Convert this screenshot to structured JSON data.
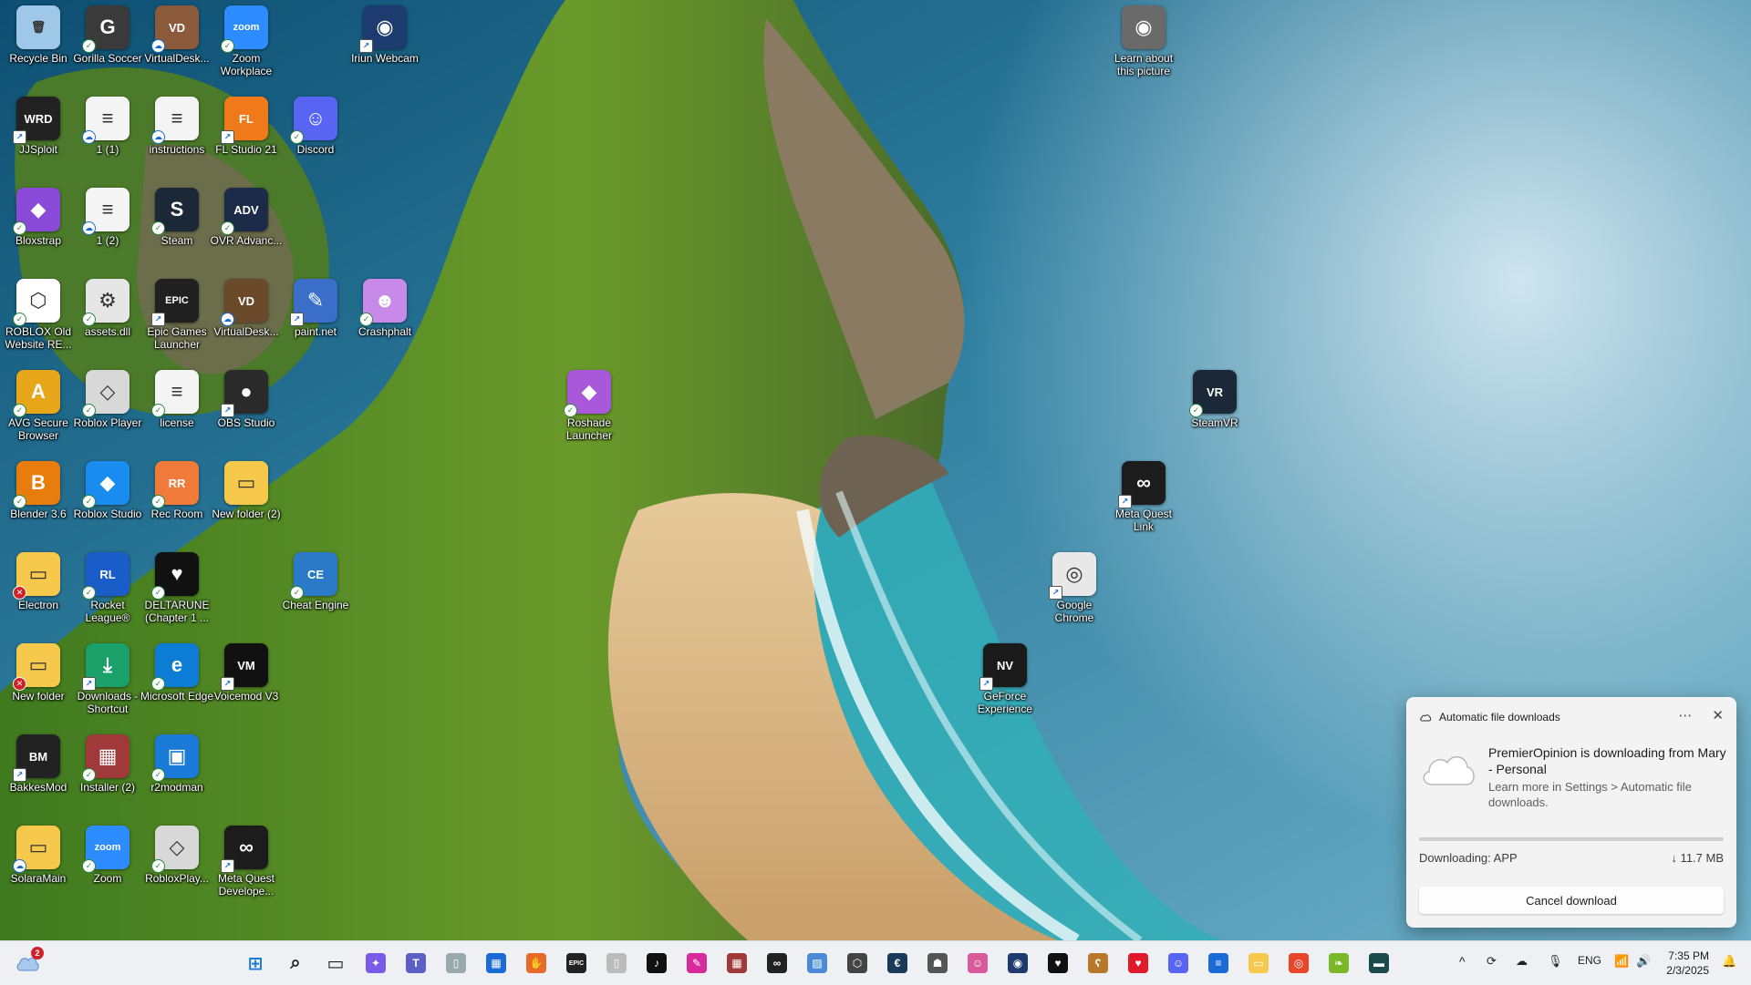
{
  "desktop": {
    "icons": [
      {
        "label": "Recycle Bin",
        "glyph": "🗑",
        "color": "#9fc7e8",
        "badge": "none"
      },
      {
        "label": "Gorilla Soccer",
        "glyph": "G",
        "color": "#3a3a3a",
        "badge": "ok"
      },
      {
        "label": "VirtualDesk...",
        "glyph": "VD",
        "color": "#8a5a3a",
        "badge": "cloud"
      },
      {
        "label": "Zoom Workplace",
        "glyph": "zoom",
        "color": "#2d8cff",
        "badge": "ok"
      },
      {
        "label": "Iriun Webcam",
        "glyph": "◉",
        "color": "#1d3b6e",
        "badge": "short"
      },
      {
        "label": "JJSploit",
        "glyph": "WRD",
        "color": "#222",
        "badge": "short"
      },
      {
        "label": "1 (1)",
        "glyph": "≡",
        "color": "#f4f4f4",
        "badge": "cloud"
      },
      {
        "label": "instructions",
        "glyph": "≡",
        "color": "#f4f4f4",
        "badge": "cloud"
      },
      {
        "label": "FL Studio 21",
        "glyph": "FL",
        "color": "#f07a1a",
        "badge": "short"
      },
      {
        "label": "Discord",
        "glyph": "☺",
        "color": "#5865f2",
        "badge": "ok"
      },
      {
        "label": "Bloxstrap",
        "glyph": "◆",
        "color": "#8a4ad8",
        "badge": "ok"
      },
      {
        "label": "1 (2)",
        "glyph": "≡",
        "color": "#f4f4f4",
        "badge": "cloud"
      },
      {
        "label": "Steam",
        "glyph": "S",
        "color": "#1b2838",
        "badge": "ok"
      },
      {
        "label": "OVR Advanc...",
        "glyph": "ADV",
        "color": "#1c2c48",
        "badge": "ok"
      },
      {
        "label": "ROBLOX Old Website RE...",
        "glyph": "⬡",
        "color": "#ffffff",
        "badge": "ok"
      },
      {
        "label": "assets.dll",
        "glyph": "⚙",
        "color": "#e6e6e6",
        "badge": "ok"
      },
      {
        "label": "Epic Games Launcher",
        "glyph": "EPIC",
        "color": "#202020",
        "badge": "short"
      },
      {
        "label": "VirtualDesk...",
        "glyph": "VD",
        "color": "#6a4a2a",
        "badge": "cloud"
      },
      {
        "label": "paint.net",
        "glyph": "✎",
        "color": "#3a6ec8",
        "badge": "short"
      },
      {
        "label": "Crashphalt",
        "glyph": "☻",
        "color": "#c78ae8",
        "badge": "ok"
      },
      {
        "label": "AVG Secure Browser",
        "glyph": "A",
        "color": "#e8a61a",
        "badge": "ok"
      },
      {
        "label": "Roblox Player",
        "glyph": "◇",
        "color": "#d8d8d8",
        "badge": "ok"
      },
      {
        "label": "license",
        "glyph": "≡",
        "color": "#f4f4f4",
        "badge": "ok"
      },
      {
        "label": "OBS Studio",
        "glyph": "●",
        "color": "#2a2a2a",
        "badge": "short"
      },
      {
        "label": "Roshade Launcher",
        "glyph": "◆",
        "color": "#a858d8",
        "badge": "ok"
      },
      {
        "label": "SteamVR",
        "glyph": "VR",
        "color": "#1b2838",
        "badge": "ok"
      },
      {
        "label": "Blender 3.6",
        "glyph": "B",
        "color": "#e87d0d",
        "badge": "ok"
      },
      {
        "label": "Roblox Studio",
        "glyph": "◆",
        "color": "#1a8cf0",
        "badge": "ok"
      },
      {
        "label": "Rec Room",
        "glyph": "RR",
        "color": "#f07a3a",
        "badge": "ok"
      },
      {
        "label": "New folder (2)",
        "glyph": "▭",
        "color": "#f6c84c",
        "badge": "none"
      },
      {
        "label": "Meta Quest Link",
        "glyph": "∞",
        "color": "#1c1c1c",
        "badge": "short"
      },
      {
        "label": "Electron",
        "glyph": "▭",
        "color": "#f6c84c",
        "badge": "err"
      },
      {
        "label": "Rocket League®",
        "glyph": "RL",
        "color": "#1a5cc8",
        "badge": "ok"
      },
      {
        "label": "DELTARUNE (Chapter 1 ...",
        "glyph": "♥",
        "color": "#111",
        "badge": "ok"
      },
      {
        "label": "Cheat Engine",
        "glyph": "CE",
        "color": "#2a7ac8",
        "badge": "ok"
      },
      {
        "label": "Google Chrome",
        "glyph": "◎",
        "color": "#e8e8e8",
        "badge": "short"
      },
      {
        "label": "New folder",
        "glyph": "▭",
        "color": "#f6c84c",
        "badge": "err"
      },
      {
        "label": "Downloads - Shortcut",
        "glyph": "⤓",
        "color": "#1aa068",
        "badge": "short"
      },
      {
        "label": "Microsoft Edge",
        "glyph": "e",
        "color": "#0c7cd5",
        "badge": "ok"
      },
      {
        "label": "Voicemod V3",
        "glyph": "VM",
        "color": "#111",
        "badge": "short"
      },
      {
        "label": "GeForce Experience",
        "glyph": "NV",
        "color": "#1a1a1a",
        "badge": "short"
      },
      {
        "label": "BakkesMod",
        "glyph": "BM",
        "color": "#222",
        "badge": "short"
      },
      {
        "label": "Installer (2)",
        "glyph": "▦",
        "color": "#a03a3a",
        "badge": "ok"
      },
      {
        "label": "r2modman",
        "glyph": "▣",
        "color": "#1a7ad8",
        "badge": "ok"
      },
      {
        "label": "SolaraMain",
        "glyph": "▭",
        "color": "#f6c84c",
        "badge": "cloud"
      },
      {
        "label": "Zoom",
        "glyph": "zoom",
        "color": "#2d8cff",
        "badge": "ok"
      },
      {
        "label": "RobloxPlay...",
        "glyph": "◇",
        "color": "#d8d8d8",
        "badge": "ok"
      },
      {
        "label": "Meta Quest Develope...",
        "glyph": "∞",
        "color": "#1c1c1c",
        "badge": "short"
      },
      {
        "label": "Learn about this picture",
        "glyph": "◉",
        "color": "#6a6a6a",
        "badge": "none"
      }
    ]
  },
  "notification": {
    "header": "Automatic file downloads",
    "more_icon": "ellipsis-icon",
    "close_icon": "close-icon",
    "title": "PremierOpinion is downloading from Mary - Personal",
    "subtitle": "Learn more in Settings > Automatic file downloads.",
    "status": "Downloading: APP",
    "size": "↓ 11.7 MB",
    "progress": 0.0,
    "cancel_label": "Cancel download"
  },
  "taskbar": {
    "weather_badge": "2",
    "apps": [
      {
        "name": "start-button",
        "glyph": "⊞",
        "color": "#1a7ad8"
      },
      {
        "name": "search-button",
        "glyph": "⌕",
        "color": "#222"
      },
      {
        "name": "task-view-button",
        "glyph": "▭",
        "color": "#222"
      },
      {
        "name": "copilot-button",
        "glyph": "✦",
        "color": "#7a5ae8"
      },
      {
        "name": "teams-button",
        "glyph": "T",
        "color": "#5b5fc7"
      },
      {
        "name": "notepad-button",
        "glyph": "▯",
        "color": "#9aa"
      },
      {
        "name": "store-button",
        "glyph": "▦",
        "color": "#1a6ad8"
      },
      {
        "name": "hand-app-button",
        "glyph": "✋",
        "color": "#e86a2a"
      },
      {
        "name": "epic-games-button",
        "glyph": "EPIC",
        "color": "#222"
      },
      {
        "name": "file-button",
        "glyph": "▯",
        "color": "#bbb"
      },
      {
        "name": "tiktok-button",
        "glyph": "♪",
        "color": "#111"
      },
      {
        "name": "app-pink-button",
        "glyph": "✎",
        "color": "#d82a9a"
      },
      {
        "name": "winrar-button",
        "glyph": "▦",
        "color": "#a03a3a"
      },
      {
        "name": "meta-button",
        "glyph": "∞",
        "color": "#222"
      },
      {
        "name": "image-button",
        "glyph": "▨",
        "color": "#4a8ad8"
      },
      {
        "name": "roblox-taskbar-button",
        "glyph": "⬡",
        "color": "#444"
      },
      {
        "name": "edge-style-button",
        "glyph": "€",
        "color": "#1a3a5a"
      },
      {
        "name": "ghost-button",
        "glyph": "☗",
        "color": "#555"
      },
      {
        "name": "character-button",
        "glyph": "☺",
        "color": "#d85a9a"
      },
      {
        "name": "iriun-button",
        "glyph": "◉",
        "color": "#1d3b6e"
      },
      {
        "name": "deltarune-button",
        "glyph": "♥",
        "color": "#111"
      },
      {
        "name": "bear-button",
        "glyph": "ʕ",
        "color": "#b8782a"
      },
      {
        "name": "heart-button",
        "glyph": "♥",
        "color": "#e01a2a"
      },
      {
        "name": "discord-button",
        "glyph": "☺",
        "color": "#5865f2"
      },
      {
        "name": "notes-button",
        "glyph": "≡",
        "color": "#1a6ad8"
      },
      {
        "name": "explorer-button",
        "glyph": "▭",
        "color": "#f6c84c"
      },
      {
        "name": "chrome-button",
        "glyph": "◎",
        "color": "#e8452a"
      },
      {
        "name": "leaf-button",
        "glyph": "❧",
        "color": "#7ab82a"
      },
      {
        "name": "terminal-button",
        "glyph": "▬",
        "color": "#1a4a4a"
      }
    ],
    "tray": {
      "chevron": "^",
      "language": "ENG",
      "time": "7:35 PM",
      "date": "2/3/2025"
    }
  }
}
